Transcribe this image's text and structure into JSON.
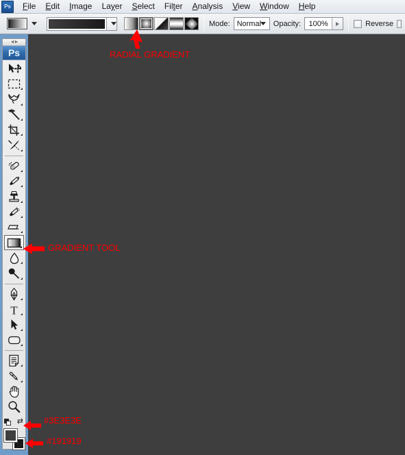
{
  "app": {
    "logo": "Ps",
    "tool_badge": "Ps"
  },
  "menubar": {
    "items": [
      {
        "label": "File",
        "mnemonic": "F"
      },
      {
        "label": "Edit",
        "mnemonic": "E"
      },
      {
        "label": "Image",
        "mnemonic": "I"
      },
      {
        "label": "Layer",
        "mnemonic": "y"
      },
      {
        "label": "Select",
        "mnemonic": "S"
      },
      {
        "label": "Filter",
        "mnemonic": "t"
      },
      {
        "label": "Analysis",
        "mnemonic": "A"
      },
      {
        "label": "View",
        "mnemonic": "V"
      },
      {
        "label": "Window",
        "mnemonic": "W"
      },
      {
        "label": "Help",
        "mnemonic": "H"
      }
    ]
  },
  "options_bar": {
    "gradient_preset_label": "gradient-preset-thumbnail",
    "gradient_strip_label": "gradient-editor-strip",
    "gradient_types": [
      {
        "name": "linear-gradient",
        "selected": false
      },
      {
        "name": "radial-gradient",
        "selected": true
      },
      {
        "name": "angle-gradient",
        "selected": false
      },
      {
        "name": "reflected-gradient",
        "selected": false
      },
      {
        "name": "diamond-gradient",
        "selected": false
      }
    ],
    "mode_label": "Mode:",
    "mode_value": "Normal",
    "opacity_label": "Opacity:",
    "opacity_value": "100%",
    "reverse_label": "Reverse",
    "reverse_checked": false,
    "dither_checked": false
  },
  "toolbar": {
    "tools": [
      {
        "name": "move-tool",
        "selected": false,
        "has_flyout": false
      },
      {
        "name": "marquee-tool",
        "selected": false,
        "has_flyout": true
      },
      {
        "name": "lasso-tool",
        "selected": false,
        "has_flyout": true
      },
      {
        "name": "magic-wand-tool",
        "selected": false,
        "has_flyout": true
      },
      {
        "name": "crop-tool",
        "selected": false,
        "has_flyout": true
      },
      {
        "name": "slice-tool",
        "selected": false,
        "has_flyout": true
      },
      {
        "name": "healing-brush-tool",
        "selected": false,
        "has_flyout": true
      },
      {
        "name": "brush-tool",
        "selected": false,
        "has_flyout": true
      },
      {
        "name": "clone-stamp-tool",
        "selected": false,
        "has_flyout": true
      },
      {
        "name": "history-brush-tool",
        "selected": false,
        "has_flyout": true
      },
      {
        "name": "eraser-tool",
        "selected": false,
        "has_flyout": true
      },
      {
        "name": "gradient-tool",
        "selected": true,
        "has_flyout": true
      },
      {
        "name": "blur-tool",
        "selected": false,
        "has_flyout": true
      },
      {
        "name": "dodge-tool",
        "selected": false,
        "has_flyout": true
      },
      {
        "name": "pen-tool",
        "selected": false,
        "has_flyout": true
      },
      {
        "name": "type-tool",
        "selected": false,
        "has_flyout": true
      },
      {
        "name": "path-selection-tool",
        "selected": false,
        "has_flyout": true
      },
      {
        "name": "shape-tool",
        "selected": false,
        "has_flyout": true
      },
      {
        "name": "notes-tool",
        "selected": false,
        "has_flyout": true
      },
      {
        "name": "eyedropper-tool",
        "selected": false,
        "has_flyout": true
      },
      {
        "name": "hand-tool",
        "selected": false,
        "has_flyout": false
      },
      {
        "name": "zoom-tool",
        "selected": false,
        "has_flyout": false
      }
    ],
    "foreground_color": "#3E3E3E",
    "background_color": "#191919"
  },
  "canvas": {
    "background_color": "#3E3E3E"
  },
  "annotations": [
    {
      "name": "annotation-radial-gradient",
      "text": "RADIAL GRADIENT",
      "color": "#FF0000"
    },
    {
      "name": "annotation-gradient-tool",
      "text": "GRADIENT TOOL",
      "color": "#FF0000"
    },
    {
      "name": "annotation-foreground-hex",
      "text": "#3E3E3E",
      "color": "#FF0000"
    },
    {
      "name": "annotation-background-hex",
      "text": "#191919",
      "color": "#FF0000"
    }
  ]
}
